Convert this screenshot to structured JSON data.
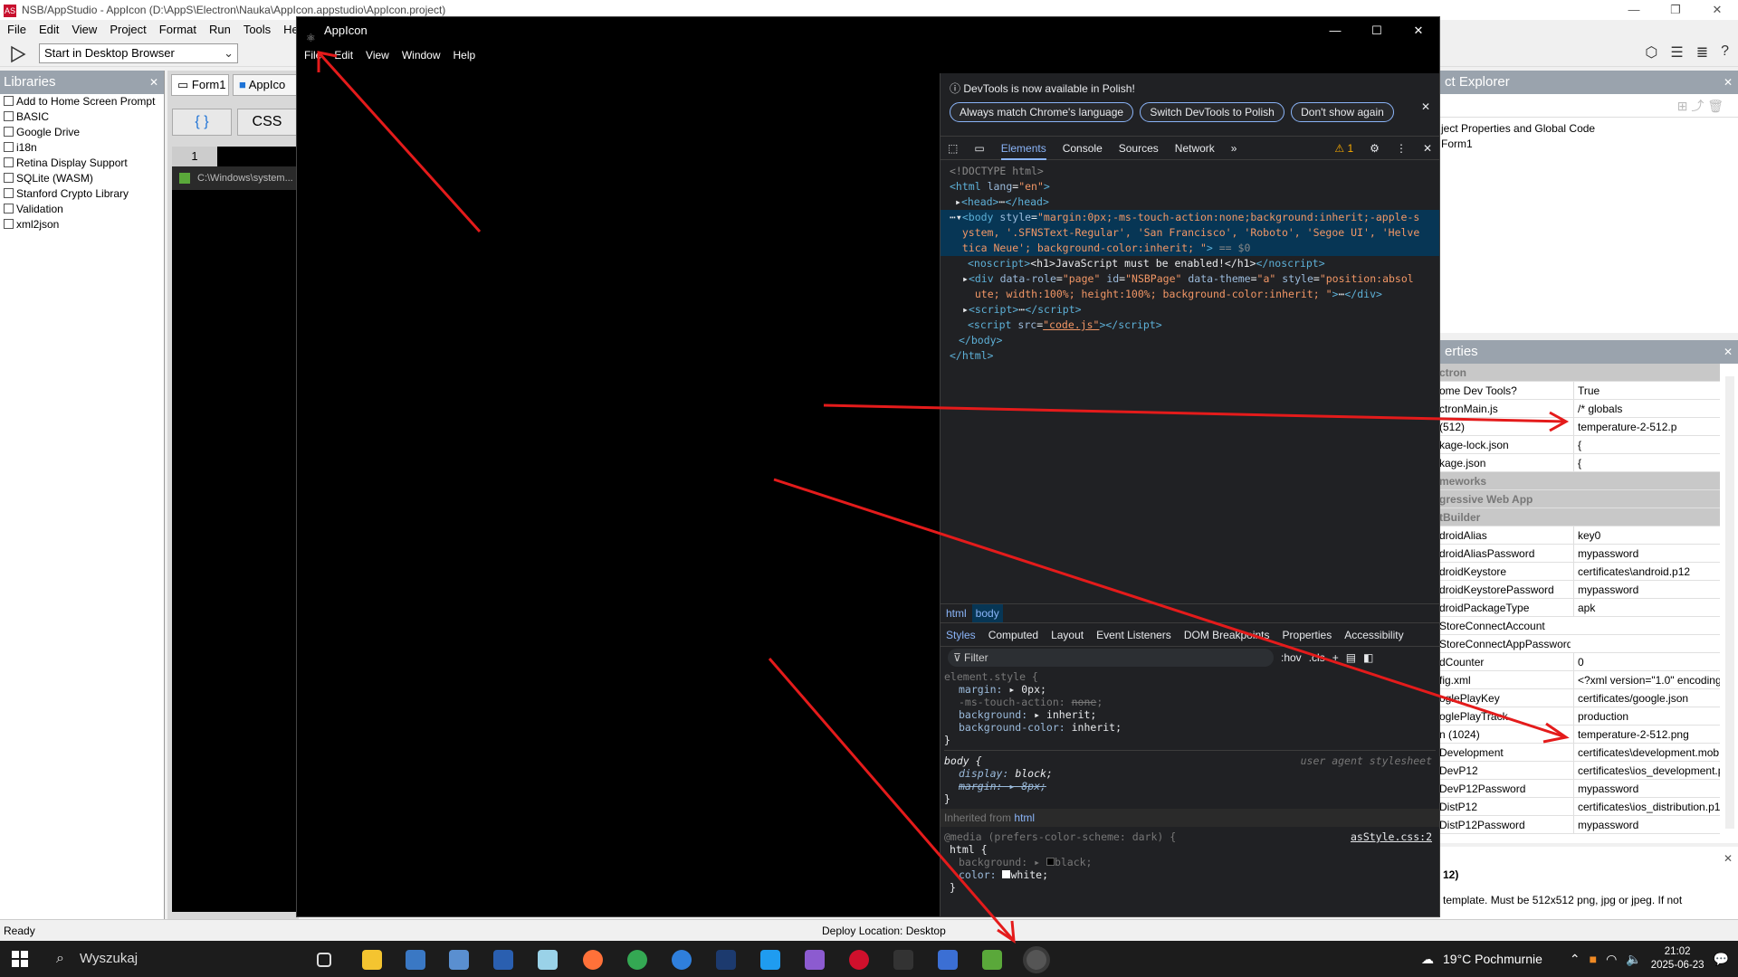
{
  "ide": {
    "title": "NSB/AppStudio - AppIcon (D:\\AppS\\Electron\\Nauka\\AppIcon.appstudio\\AppIcon.project)",
    "menu": [
      "File",
      "Edit",
      "View",
      "Project",
      "Format",
      "Run",
      "Tools",
      "Help"
    ],
    "run_target": "Start in Desktop Browser",
    "status_left": "Ready",
    "status_center": "Deploy Location: Desktop"
  },
  "libraries": {
    "title": "Libraries",
    "items": [
      "Add to Home Screen Prompt",
      "BASIC",
      "Google Drive",
      "i18n",
      "Retina Display Support",
      "SQLite (WASM)",
      "Stanford Crypto Library",
      "Validation",
      "xml2json"
    ]
  },
  "editor": {
    "tabs": [
      "Form1",
      "AppIco"
    ],
    "code_btn": "{ }",
    "css_btn": "CSS",
    "line_number": "1",
    "cmd_title": "C:\\Windows\\system..."
  },
  "explorer": {
    "title": "ct Explorer",
    "items": [
      "ject Properties and Global Code",
      "Form1"
    ]
  },
  "properties": {
    "title": "erties",
    "rows": [
      {
        "k": "ctron",
        "v": "",
        "cat": true
      },
      {
        "k": "ome Dev Tools?",
        "v": "True"
      },
      {
        "k": "ctronMain.js",
        "v": "/* globals"
      },
      {
        "k": "(512)",
        "v": "temperature-2-512.p"
      },
      {
        "k": "kage-lock.json",
        "v": "{"
      },
      {
        "k": "kage.json",
        "v": "{"
      },
      {
        "k": "meworks",
        "v": "",
        "cat": true
      },
      {
        "k": "gressive Web App",
        "v": "",
        "cat": true
      },
      {
        "k": "tBuilder",
        "v": "",
        "cat": true
      },
      {
        "k": "droidAlias",
        "v": "key0"
      },
      {
        "k": "droidAliasPassword",
        "v": "mypassword"
      },
      {
        "k": "droidKeystore",
        "v": "certificates\\android.p12"
      },
      {
        "k": "droidKeystorePassword",
        "v": "mypassword"
      },
      {
        "k": "droidPackageType",
        "v": "apk"
      },
      {
        "k": "StoreConnectAccount",
        "v": ""
      },
      {
        "k": "StoreConnectAppPassword",
        "v": ""
      },
      {
        "k": "dCounter",
        "v": "0"
      },
      {
        "k": "fig.xml",
        "v": "<?xml version=\"1.0\" encoding"
      },
      {
        "k": "oglePlayKey",
        "v": "certificates/google.json"
      },
      {
        "k": "oglePlayTrack",
        "v": "production"
      },
      {
        "k": "n (1024)",
        "v": "temperature-2-512.png"
      },
      {
        "k": "Development",
        "v": "certificates\\development.mob"
      },
      {
        "k": "DevP12",
        "v": "certificates\\ios_development.p"
      },
      {
        "k": "DevP12Password",
        "v": "mypassword"
      },
      {
        "k": "DistP12",
        "v": "certificates\\ios_distribution.p1"
      },
      {
        "k": "DistP12Password",
        "v": "mypassword"
      }
    ]
  },
  "help": {
    "heading": "12)",
    "text": "template. Must be 512x512 png, jpg or jpeg. If not"
  },
  "app": {
    "title": "AppIcon",
    "menu": [
      "File",
      "Edit",
      "View",
      "Window",
      "Help"
    ]
  },
  "devtools": {
    "info": "DevTools is now available in Polish!",
    "btn1": "Always match Chrome's language",
    "btn2": "Switch DevTools to Polish",
    "btn3": "Don't show again",
    "tabs": [
      "Elements",
      "Console",
      "Sources",
      "Network"
    ],
    "warnings": "1",
    "crumbs": [
      "html",
      "body"
    ],
    "subtabs": [
      "Styles",
      "Computed",
      "Layout",
      "Event Listeners",
      "DOM Breakpoints",
      "Properties",
      "Accessibility"
    ],
    "filter": "Filter",
    "hov": ":hov",
    "cls": ".cls",
    "inherited_label": "Inherited from",
    "inherited_tag": "html",
    "media": "@media (prefers-color-scheme: dark) {",
    "media_src": "asStyle.css:2",
    "ua": "user agent stylesheet"
  },
  "taskbar": {
    "search": "Wyszukaj",
    "weather": "19°C  Pochmurnie",
    "time": "21:02",
    "date": "2025-06-23"
  }
}
